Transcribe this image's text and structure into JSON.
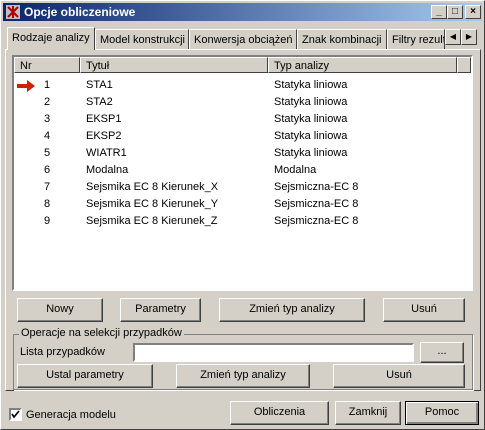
{
  "window": {
    "title": "Opcje obliczeniowe",
    "app_icon": "robot-app-icon"
  },
  "title_buttons": {
    "minimize": "_",
    "maximize": "□",
    "close": "×"
  },
  "tabs": [
    {
      "label": "Rodzaje analizy",
      "active": true
    },
    {
      "label": "Model konstrukcji",
      "active": false
    },
    {
      "label": "Konwersja obciążeń",
      "active": false
    },
    {
      "label": "Znak kombinacji",
      "active": false
    },
    {
      "label": "Filtry rezulta",
      "active": false
    }
  ],
  "tab_scroll": {
    "left": "◀",
    "right": "▶"
  },
  "table": {
    "columns": [
      "Nr",
      "Tytuł",
      "Typ analizy"
    ],
    "current_row_icon": "arrow-right-icon",
    "current_row_color": "#cc2200",
    "rows": [
      {
        "nr": "1",
        "title": "STA1",
        "type": "Statyka liniowa"
      },
      {
        "nr": "2",
        "title": "STA2",
        "type": "Statyka liniowa"
      },
      {
        "nr": "3",
        "title": "EKSP1",
        "type": "Statyka liniowa"
      },
      {
        "nr": "4",
        "title": "EKSP2",
        "type": "Statyka liniowa"
      },
      {
        "nr": "5",
        "title": "WIATR1",
        "type": "Statyka liniowa"
      },
      {
        "nr": "6",
        "title": "Modalna",
        "type": "Modalna"
      },
      {
        "nr": "7",
        "title": "Sejsmika EC 8 Kierunek_X",
        "type": "Sejsmiczna-EC 8"
      },
      {
        "nr": "8",
        "title": "Sejsmika EC 8 Kierunek_Y",
        "type": "Sejsmiczna-EC 8"
      },
      {
        "nr": "9",
        "title": "Sejsmika EC 8 Kierunek_Z",
        "type": "Sejsmiczna-EC 8"
      }
    ]
  },
  "list_buttons": {
    "new": "Nowy",
    "params": "Parametry",
    "change_type": "Zmień typ analizy",
    "delete": "Usuń"
  },
  "selection_group": {
    "title": "Operacje na selekcji przypadków",
    "list_label": "Lista przypadków",
    "list_value": "",
    "browse": "...",
    "set_params": "Ustal parametry",
    "change_type": "Zmień typ analizy",
    "delete": "Usuń"
  },
  "footer": {
    "generate_model_label": "Generacja modelu",
    "generate_model_checked": true,
    "calc": "Obliczenia",
    "close": "Zamknij",
    "help": "Pomoc"
  }
}
